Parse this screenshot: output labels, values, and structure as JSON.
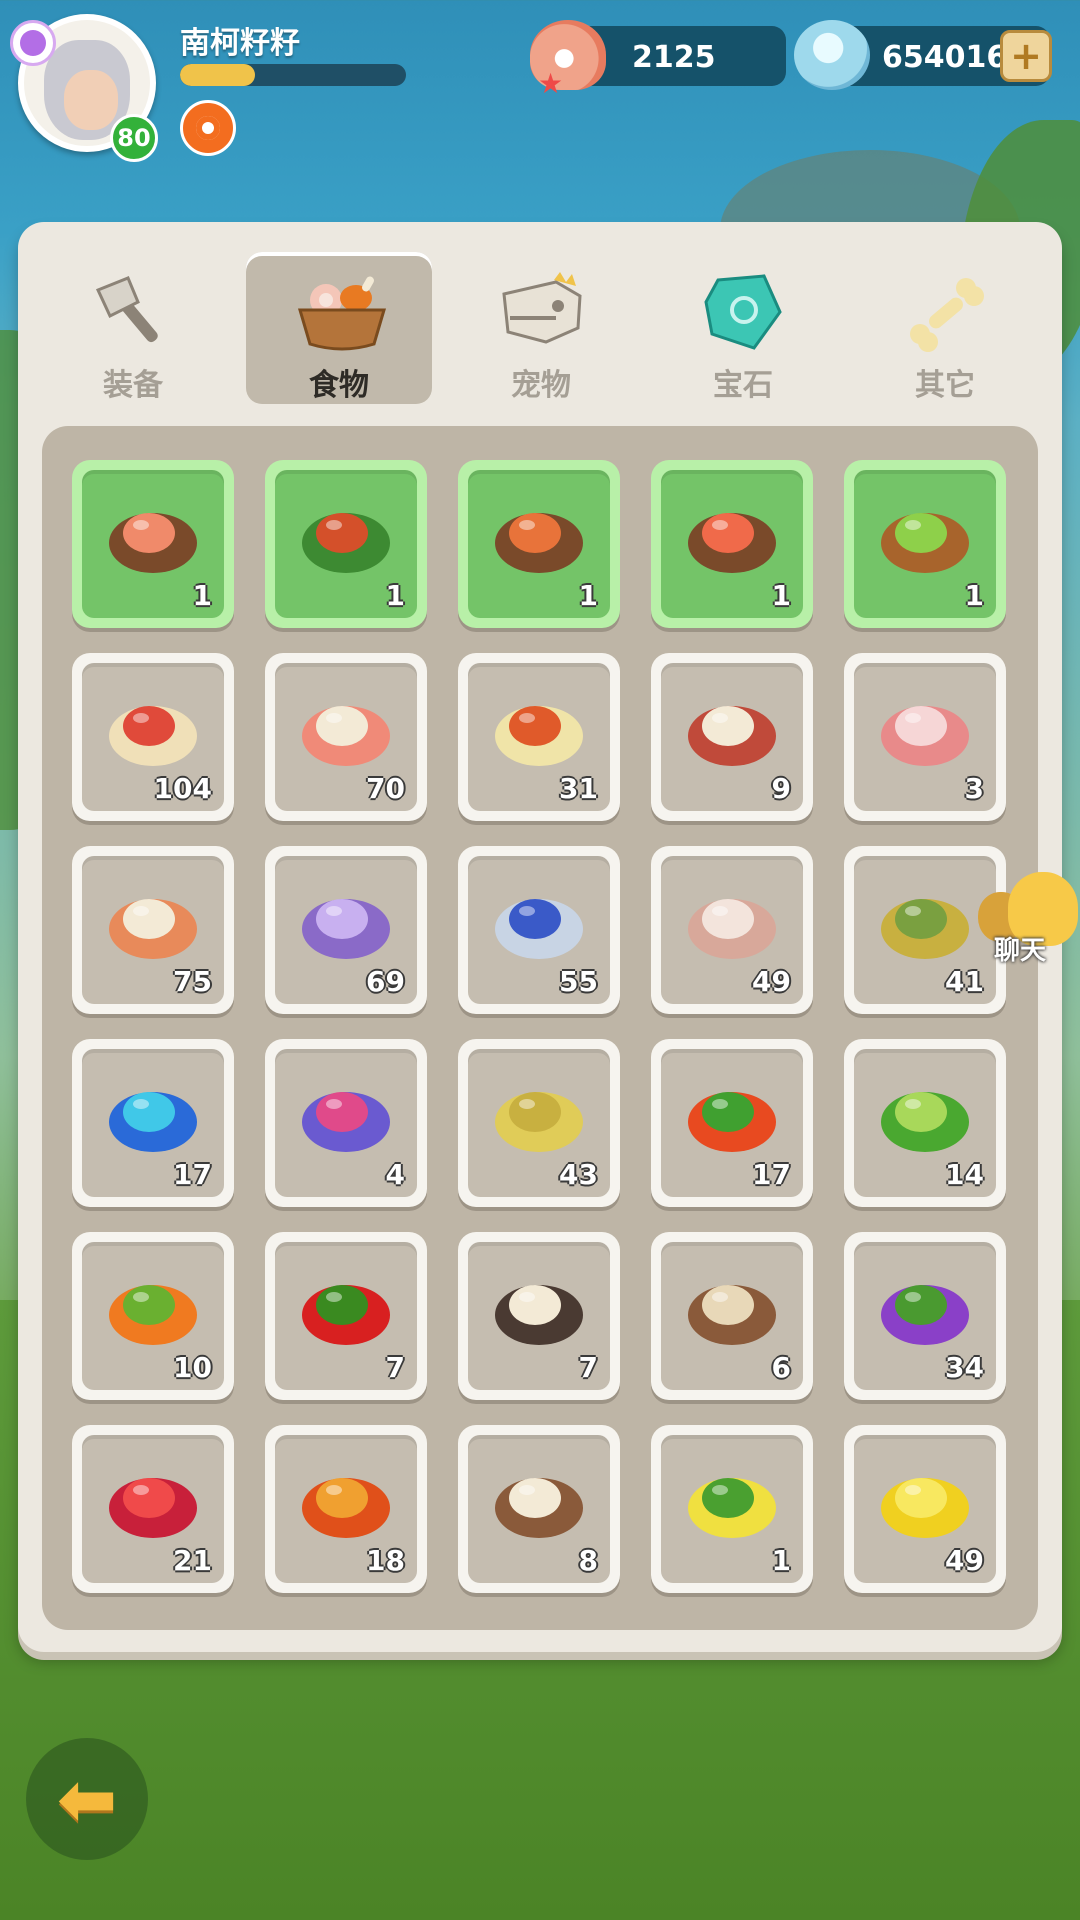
{
  "player": {
    "name": "南柯籽籽",
    "level": "80",
    "xp_progress": 0.33
  },
  "currency": {
    "pearls": "2125",
    "gems": "654016",
    "add_label": "+"
  },
  "tabs": [
    {
      "label": "装备",
      "icon": "stone-axe-icon",
      "active": false
    },
    {
      "label": "食物",
      "icon": "food-basket-icon",
      "active": true
    },
    {
      "label": "宠物",
      "icon": "dino-skull-icon",
      "active": false
    },
    {
      "label": "宝石",
      "icon": "gem-icon",
      "active": false
    },
    {
      "label": "其它",
      "icon": "bone-icon",
      "active": false
    }
  ],
  "items": [
    {
      "name": "shrimp-salad-dish",
      "qty": "1",
      "cooked": true
    },
    {
      "name": "roast-ham-dish",
      "qty": "1",
      "cooked": true
    },
    {
      "name": "seafood-platter-dish",
      "qty": "1",
      "cooked": true
    },
    {
      "name": "sushi-platter-dish",
      "qty": "1",
      "cooked": true
    },
    {
      "name": "green-soup-bowl",
      "qty": "1",
      "cooked": true
    },
    {
      "name": "raw-meat-steak",
      "qty": "104",
      "cooked": false
    },
    {
      "name": "chicken-leg",
      "qty": "70",
      "cooked": false
    },
    {
      "name": "spotted-egg",
      "qty": "31",
      "cooked": false
    },
    {
      "name": "ham-leg",
      "qty": "9",
      "cooked": false
    },
    {
      "name": "ribs",
      "qty": "3",
      "cooked": false
    },
    {
      "name": "pufferfish",
      "qty": "75",
      "cooked": false
    },
    {
      "name": "octopus",
      "qty": "69",
      "cooked": false
    },
    {
      "name": "swordfish",
      "qty": "55",
      "cooked": false
    },
    {
      "name": "scallop-shell",
      "qty": "49",
      "cooked": false
    },
    {
      "name": "shrimp",
      "qty": "41",
      "cooked": false
    },
    {
      "name": "blue-lobster",
      "qty": "17",
      "cooked": false
    },
    {
      "name": "crab",
      "qty": "4",
      "cooked": false
    },
    {
      "name": "potato",
      "qty": "43",
      "cooked": false
    },
    {
      "name": "tomato",
      "qty": "17",
      "cooked": false
    },
    {
      "name": "broccoli",
      "qty": "14",
      "cooked": false
    },
    {
      "name": "carrot",
      "qty": "10",
      "cooked": false
    },
    {
      "name": "chili-pepper",
      "qty": "7",
      "cooked": false
    },
    {
      "name": "truffle",
      "qty": "7",
      "cooked": false
    },
    {
      "name": "mushroom",
      "qty": "6",
      "cooked": false
    },
    {
      "name": "grapes",
      "qty": "34",
      "cooked": false
    },
    {
      "name": "pomegranate",
      "qty": "21",
      "cooked": false
    },
    {
      "name": "apple",
      "qty": "18",
      "cooked": false
    },
    {
      "name": "coconut",
      "qty": "8",
      "cooked": false
    },
    {
      "name": "pineapple",
      "qty": "1",
      "cooked": false
    },
    {
      "name": "honeycomb",
      "qty": "49",
      "cooked": false
    }
  ],
  "chat": {
    "label": "聊天"
  },
  "colors": {
    "panel": "#ece8e0",
    "grid_bg": "#beb5a6",
    "cooked_slot": "#74c468",
    "accent_gold": "#f5b93c"
  }
}
